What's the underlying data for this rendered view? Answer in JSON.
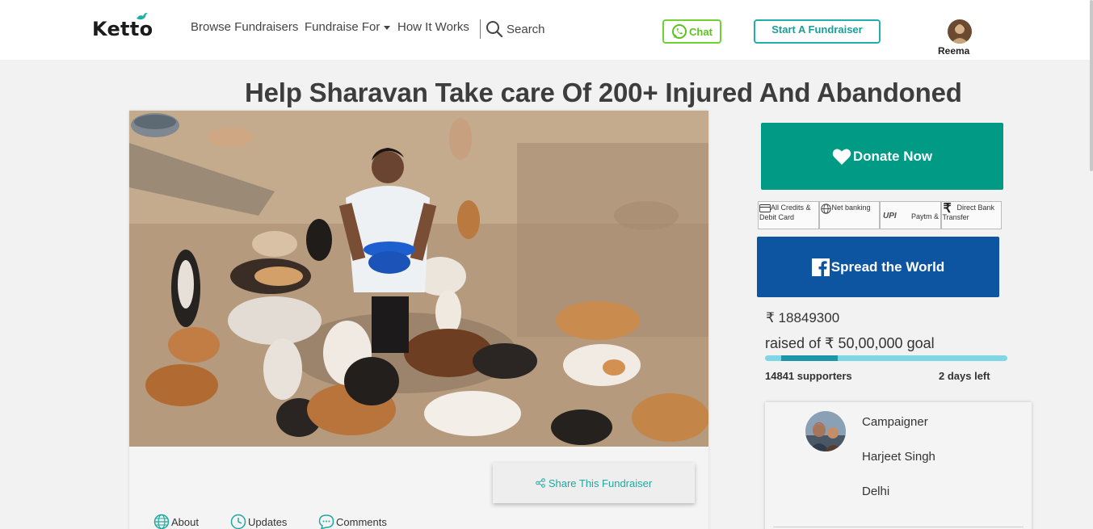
{
  "header": {
    "logo": "Ketto",
    "nav": {
      "browse": "Browse Fundraisers",
      "fundraise_for": "Fundraise For",
      "how_it_works": "How It Works",
      "search": "Search"
    },
    "chat_label": "Chat",
    "start_label": "Start A Fundraiser",
    "user_name": "Reema"
  },
  "campaign": {
    "title": "Help Sharavan Take care Of 200+ Injured And Abandoned"
  },
  "share_label": "Share This Fundraiser",
  "tabs": {
    "about": "About",
    "updates": "Updates",
    "comments": "Comments"
  },
  "donate": {
    "label": "Donate Now",
    "payment_methods": [
      "All Credits & Debit Card",
      "Net banking",
      "Paytm &",
      "Direct Bank Transfer"
    ],
    "upi_logo": "UPI"
  },
  "spread_label": "Spread the World",
  "funding": {
    "raised_text": "₹ 18849300",
    "goal_text": "raised of ₹ 50,00,000 goal",
    "supporters": "14841 supporters",
    "days_left": "2 days left",
    "progress_percent": 30
  },
  "campaigner": {
    "role": "Campaigner",
    "name": "Harjeet Singh",
    "location": "Delhi"
  },
  "colors": {
    "brand_teal": "#009a85",
    "facebook_blue": "#0d55a0",
    "chat_green": "#6fd231",
    "progress_fill": "#1c97a8",
    "progress_track": "#7fd6e4"
  }
}
